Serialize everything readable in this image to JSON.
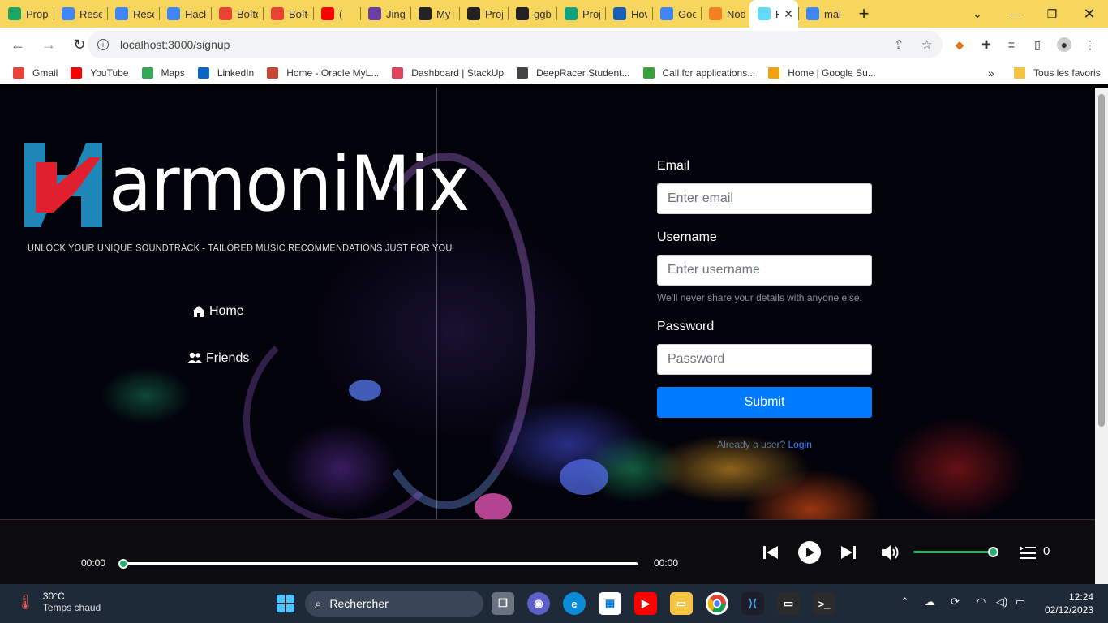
{
  "browser": {
    "tabs": [
      {
        "title": "Prop",
        "icon": "google-drive-icon",
        "color": "#1fa463"
      },
      {
        "title": "Rese",
        "icon": "google-docs-icon",
        "color": "#4285f4"
      },
      {
        "title": "Rese",
        "icon": "google-docs-icon",
        "color": "#4285f4"
      },
      {
        "title": "Hack",
        "icon": "google-docs-icon",
        "color": "#4285f4"
      },
      {
        "title": "Boîte",
        "icon": "gmail-icon",
        "color": "#ea4335"
      },
      {
        "title": "Boîte",
        "icon": "gmail-icon",
        "color": "#ea4335"
      },
      {
        "title": "(",
        "icon": "youtube-icon",
        "color": "#ff0000"
      },
      {
        "title": "Jingl",
        "icon": "jingle-icon",
        "color": "#6b3fa0"
      },
      {
        "title": "My p",
        "icon": "alx-icon",
        "color": "#222"
      },
      {
        "title": "Proj",
        "icon": "alx-icon",
        "color": "#222"
      },
      {
        "title": "ggb",
        "icon": "github-icon",
        "color": "#222"
      },
      {
        "title": "Proj",
        "icon": "openai-icon",
        "color": "#10a37f"
      },
      {
        "title": "How",
        "icon": "drive-icon",
        "color": "#1a5fb4"
      },
      {
        "title": "Goo",
        "icon": "google-translate-icon",
        "color": "#4285f4"
      },
      {
        "title": "Nod",
        "icon": "stackoverflow-icon",
        "color": "#f48024"
      },
      {
        "title": "H",
        "icon": "react-icon",
        "color": "#61dafb"
      },
      {
        "title": "mak",
        "icon": "google-icon",
        "color": "#4285f4"
      }
    ],
    "url": "localhost:3000/signup",
    "bookmarks": [
      {
        "label": "Gmail",
        "icon": "gmail-icon",
        "color": "#ea4335"
      },
      {
        "label": "YouTube",
        "icon": "youtube-icon",
        "color": "#ff0000"
      },
      {
        "label": "Maps",
        "icon": "maps-icon",
        "color": "#34a853"
      },
      {
        "label": "LinkedIn",
        "icon": "linkedin-icon",
        "color": "#0a66c2"
      },
      {
        "label": "Home - Oracle MyL...",
        "icon": "oracle-icon",
        "color": "#c74634"
      },
      {
        "label": "Dashboard | StackUp",
        "icon": "stackup-icon",
        "color": "#e0445a"
      },
      {
        "label": "DeepRacer Student...",
        "icon": "deepracer-icon",
        "color": "#444"
      },
      {
        "label": "Call for applications...",
        "icon": "recycle-icon",
        "color": "#3aa13a"
      },
      {
        "label": "Home | Google Su...",
        "icon": "sun-icon",
        "color": "#f2a20c"
      }
    ],
    "all_bookmarks": "Tous les favoris"
  },
  "app": {
    "logo_text": "armoniMix",
    "tagline": "UNLOCK YOUR UNIQUE SOUNDTRACK - TAILORED MUSIC RECOMMENDATIONS JUST FOR YOU",
    "nav": [
      {
        "label": "Home",
        "icon": "home-icon"
      },
      {
        "label": "Friends",
        "icon": "users-icon"
      }
    ],
    "form": {
      "email_label": "Email",
      "email_placeholder": "Enter email",
      "username_label": "Username",
      "username_placeholder": "Enter username",
      "help_text": "We'll never share your details with anyone else.",
      "password_label": "Password",
      "password_placeholder": "Password",
      "submit_label": "Submit",
      "already_text": "Already a user?",
      "login_link": "Login"
    },
    "player": {
      "current_time": "00:00",
      "duration": "00:00",
      "progress": 0,
      "volume": 1.0,
      "queue_count": "0"
    }
  },
  "taskbar": {
    "temperature": "30°C",
    "weather": "Temps chaud",
    "search_label": "Rechercher",
    "time": "12:24",
    "date": "02/12/2023"
  }
}
